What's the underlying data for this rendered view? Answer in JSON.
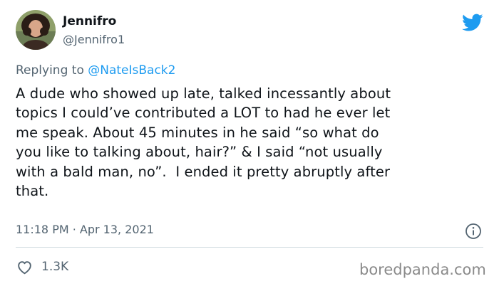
{
  "author": {
    "name": "Jennifro",
    "handle": "@Jennifro1",
    "avatar": "avatar-photo"
  },
  "reply": {
    "prefix": "Replying to ",
    "mention": "@NateIsBack2"
  },
  "tweet": {
    "text": "A dude who showed up late, talked incessantly about\ntopics I could’ve contributed a LOT to had he ever let\nme speak. About 45 minutes in he said “so what do\nyou like to talking about, hair?” & I said “not usually\nwith a bald man, no”.  I ended it pretty abruptly after\nthat.",
    "timestamp": "11:18 PM · Apr 13, 2021"
  },
  "engagement": {
    "likes": "1.3K"
  },
  "icons": {
    "platform": "twitter-bird-icon",
    "info": "info-icon",
    "like": "heart-icon"
  },
  "colors": {
    "brand": "#1d9bf0",
    "text": "#0f1419",
    "secondary": "#536471",
    "divider": "#cfd9de"
  },
  "watermark": "boredpanda.com"
}
